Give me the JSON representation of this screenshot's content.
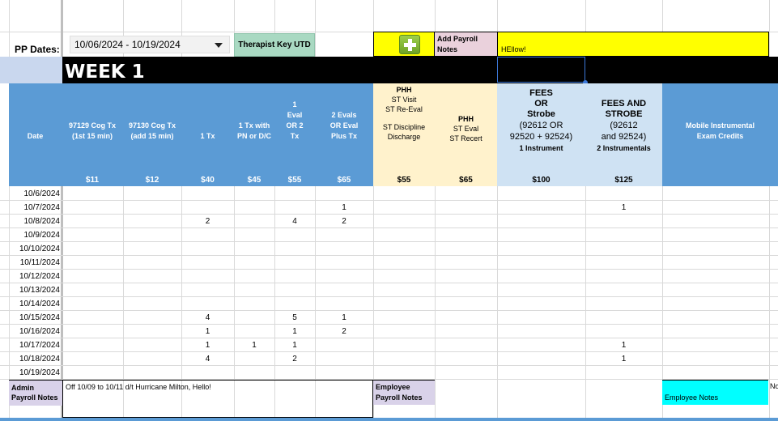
{
  "header": {
    "pp_label": "PP Dates:",
    "pp_value": "10/06/2024 - 10/19/2024",
    "therapist_key": "Therapist Key UTD",
    "add_notes_label": "Add Payroll Notes",
    "payroll_notes_text": "HEllow!"
  },
  "week": {
    "title": "WEEK 1"
  },
  "columns": [
    {
      "id": "date",
      "label": "Date",
      "price": ""
    },
    {
      "id": "c97129",
      "label": "97129 Cog Tx (1st 15 min)",
      "price": "$11"
    },
    {
      "id": "c97130",
      "label": "97130 Cog Tx (add 15 min)",
      "price": "$12"
    },
    {
      "id": "tx1",
      "label": "1 Tx",
      "price": "$40"
    },
    {
      "id": "txpn",
      "label": "1 Tx with PN or D/C",
      "price": "$45"
    },
    {
      "id": "eval1",
      "label": "1 Eval OR 2 Tx",
      "price": "$55"
    },
    {
      "id": "eval2",
      "label": "2 Evals OR Eval Plus Tx",
      "price": "$65"
    },
    {
      "id": "phh1",
      "label_lines": [
        "PHH",
        "ST Visit",
        "ST Re-Eval",
        "",
        "ST Discipline",
        "Discharge"
      ],
      "price": "$55"
    },
    {
      "id": "phh2",
      "label_lines": [
        "PHH",
        "ST Eval",
        "ST Recert"
      ],
      "price": "$65"
    },
    {
      "id": "fees1",
      "label_lines": [
        "FEES",
        "OR",
        "Strobe",
        "(92612 OR",
        "92520 + 92524)",
        "1 Instrument"
      ],
      "price": "$100"
    },
    {
      "id": "fees2",
      "label_lines": [
        "FEES AND",
        "STROBE",
        "(92612",
        "and 92524)",
        "2 Instrumentals"
      ],
      "price": "$125"
    },
    {
      "id": "mobile",
      "label": "Mobile Instrumental Exam Credits",
      "price": ""
    }
  ],
  "rows": [
    {
      "date": "10/6/2024",
      "vals": [
        "",
        "",
        "",
        "",
        "",
        "",
        "",
        "",
        "",
        "",
        ""
      ]
    },
    {
      "date": "10/7/2024",
      "vals": [
        "",
        "",
        "",
        "",
        "",
        "1",
        "",
        "",
        "",
        "1",
        ""
      ]
    },
    {
      "date": "10/8/2024",
      "vals": [
        "",
        "",
        "2",
        "",
        "4",
        "2",
        "",
        "",
        "",
        "",
        ""
      ]
    },
    {
      "date": "10/9/2024",
      "vals": [
        "",
        "",
        "",
        "",
        "",
        "",
        "",
        "",
        "",
        "",
        ""
      ]
    },
    {
      "date": "10/10/2024",
      "vals": [
        "",
        "",
        "",
        "",
        "",
        "",
        "",
        "",
        "",
        "",
        ""
      ]
    },
    {
      "date": "10/11/2024",
      "vals": [
        "",
        "",
        "",
        "",
        "",
        "",
        "",
        "",
        "",
        "",
        ""
      ]
    },
    {
      "date": "10/12/2024",
      "vals": [
        "",
        "",
        "",
        "",
        "",
        "",
        "",
        "",
        "",
        "",
        ""
      ]
    },
    {
      "date": "10/13/2024",
      "vals": [
        "",
        "",
        "",
        "",
        "",
        "",
        "",
        "",
        "",
        "",
        ""
      ]
    },
    {
      "date": "10/14/2024",
      "vals": [
        "",
        "",
        "",
        "",
        "",
        "",
        "",
        "",
        "",
        "",
        ""
      ]
    },
    {
      "date": "10/15/2024",
      "vals": [
        "",
        "",
        "4",
        "",
        "5",
        "1",
        "",
        "",
        "",
        "",
        ""
      ]
    },
    {
      "date": "10/16/2024",
      "vals": [
        "",
        "",
        "1",
        "",
        "1",
        "2",
        "",
        "",
        "",
        "",
        ""
      ]
    },
    {
      "date": "10/17/2024",
      "vals": [
        "",
        "",
        "1",
        "1",
        "1",
        "",
        "",
        "",
        "",
        "1",
        ""
      ]
    },
    {
      "date": "10/18/2024",
      "vals": [
        "",
        "",
        "4",
        "",
        "2",
        "",
        "",
        "",
        "",
        "1",
        ""
      ]
    },
    {
      "date": "10/19/2024",
      "vals": [
        "",
        "",
        "",
        "",
        "",
        "",
        "",
        "",
        "",
        "",
        ""
      ]
    }
  ],
  "footer": {
    "admin_label": "Admin Payroll Notes",
    "admin_notes": "Off 10/09 to 10/11 d/t Hurricane Milton, Hello!",
    "employee_payroll_label": "Employee Payroll Notes",
    "employee_notes_label": "Employee Notes",
    "cut_text": "No"
  },
  "colors": {
    "header_blue": "#5b9bd5",
    "peach": "#fff2cc",
    "light_blue": "#cfe2f3",
    "yellow": "#ffff00",
    "cyan": "#00ffff",
    "mint": "#a9d9c2",
    "lavender": "#d9d2e9"
  }
}
